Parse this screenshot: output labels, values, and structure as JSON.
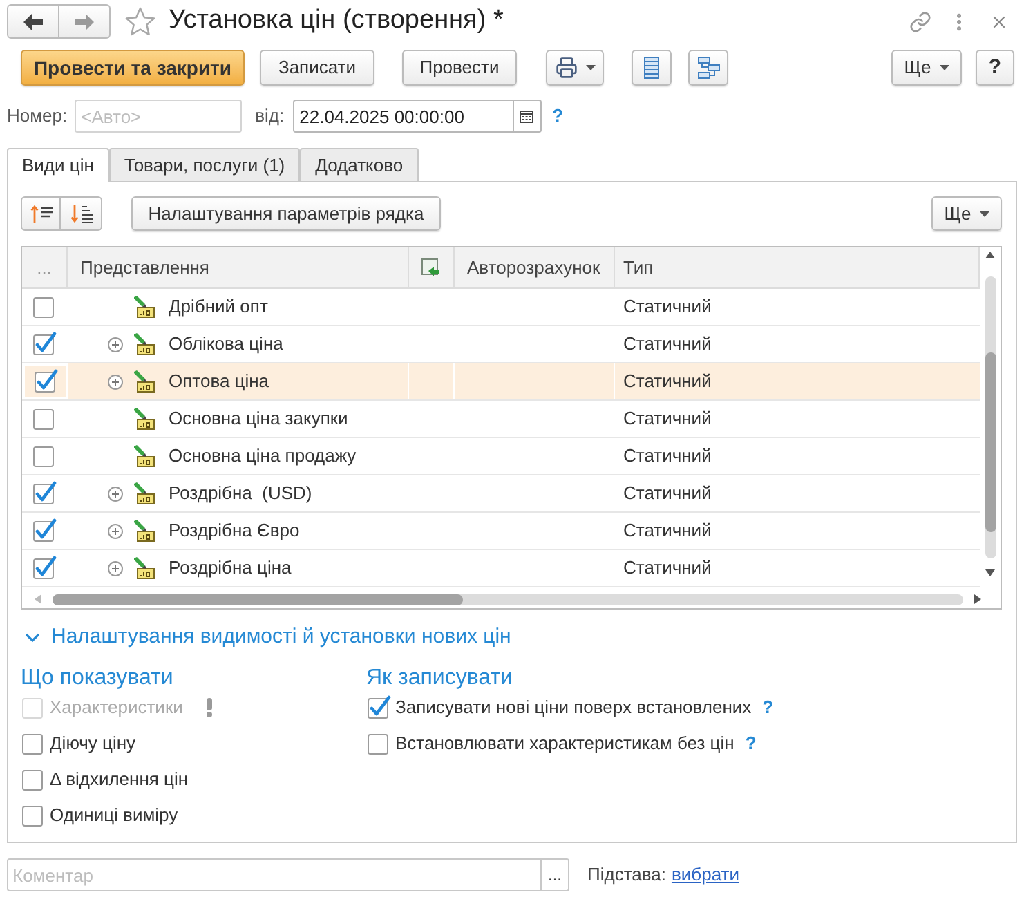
{
  "window": {
    "title": "Установка цін (створення) *"
  },
  "toolbar": {
    "buttons": [
      {
        "label": "Провести та закрити",
        "kind": "primary"
      },
      {
        "label": "Записати",
        "kind": "plain"
      },
      {
        "label": "Провести",
        "kind": "plain"
      }
    ],
    "more": "Ще",
    "help": "?"
  },
  "header": {
    "number": {
      "label": "Номер:",
      "placeholder": "<Авто>"
    },
    "date": {
      "label": "від:",
      "value": "22.04.2025 00:00:00"
    },
    "help": "?"
  },
  "tabs": [
    {
      "label": "Види цін",
      "selected": true
    },
    {
      "label": "Товари, послуги (1)",
      "selected": false
    },
    {
      "label": "Додатково",
      "selected": false
    }
  ],
  "tab_toolbar": {
    "settings_button": "Налаштування параметрів рядка",
    "more": "Ще"
  },
  "table": {
    "columns": [
      {
        "kind": "text",
        "label": "..."
      },
      {
        "kind": "text",
        "label": "Представлення"
      },
      {
        "kind": "icon"
      },
      {
        "kind": "text",
        "label": "Авторозрахунок"
      },
      {
        "kind": "text",
        "label": "Тип"
      }
    ],
    "rows": [
      {
        "name": "Дрібний опт",
        "type": "Статичний",
        "checked": false,
        "expandable": false,
        "selected": false
      },
      {
        "name": "Облікова ціна",
        "type": "Статичний",
        "checked": true,
        "expandable": true,
        "selected": false
      },
      {
        "name": "Оптова ціна",
        "type": "Статичний",
        "checked": true,
        "expandable": true,
        "selected": true
      },
      {
        "name": "Основна ціна закупки",
        "type": "Статичний",
        "checked": false,
        "expandable": false,
        "selected": false
      },
      {
        "name": "Основна ціна продажу",
        "type": "Статичний",
        "checked": false,
        "expandable": false,
        "selected": false
      },
      {
        "name": "Роздрібна  (USD)",
        "type": "Статичний",
        "checked": true,
        "expandable": true,
        "selected": false
      },
      {
        "name": "Роздрібна Євро",
        "type": "Статичний",
        "checked": true,
        "expandable": true,
        "selected": false
      },
      {
        "name": "Роздрібна ціна",
        "type": "Статичний",
        "checked": true,
        "expandable": true,
        "selected": false
      }
    ]
  },
  "visibility_section": {
    "title": "Налаштування видимості й установки нових цін",
    "expanded": true,
    "groups": [
      {
        "title": "Що показувати",
        "options": [
          {
            "label": "Характеристики",
            "checked": false,
            "disabled": true,
            "warning": true
          },
          {
            "label": "Діючу ціну",
            "checked": false,
            "disabled": false,
            "warning": false
          },
          {
            "label": "Δ відхилення цін",
            "checked": false,
            "disabled": false,
            "warning": false
          },
          {
            "label": "Одиниці виміру",
            "checked": false,
            "disabled": false,
            "warning": false
          }
        ]
      },
      {
        "title": "Як записувати",
        "options": [
          {
            "label": "Записувати нові ціни поверх встановлених",
            "checked": true,
            "disabled": false,
            "warning": false,
            "help": "?"
          },
          {
            "label": "Встановлювати характеристикам без цін",
            "checked": false,
            "disabled": false,
            "warning": false,
            "help": "?"
          }
        ]
      }
    ]
  },
  "footer": {
    "comment": {
      "placeholder": "Коментар",
      "button": "..."
    },
    "basis": {
      "label": "Підстава:",
      "link": "вибрати"
    }
  }
}
